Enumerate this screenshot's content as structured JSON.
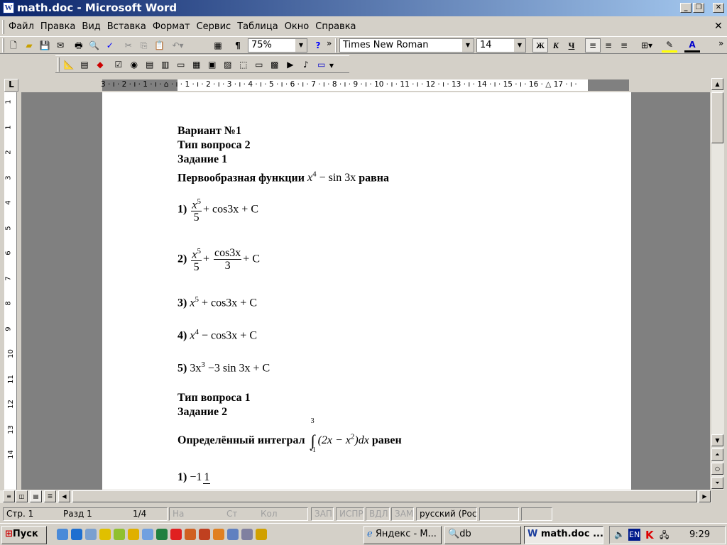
{
  "window": {
    "title": "math.doc - Microsoft Word",
    "icon_letter": "W",
    "minimize": "_",
    "restore": "❐",
    "close": "✕"
  },
  "menu": {
    "items": [
      "Файл",
      "Правка",
      "Вид",
      "Вставка",
      "Формат",
      "Сервис",
      "Таблица",
      "Окно",
      "Справка"
    ],
    "close_doc": "✕"
  },
  "toolbar": {
    "zoom": "75%",
    "pilcrow": "¶",
    "help": "?",
    "font": "Times New Roman",
    "size": "14",
    "bold": "Ж",
    "italic": "К",
    "underline": "Ч",
    "more": "»"
  },
  "ruler": {
    "corner": "L",
    "numbers": "3 · ı · 2 · ı · 1 · ı · ⌂ · ı · 1 · ı · 2 · ı · 3 · ı · 4 · ı · 5 · ı · 6 · ı · 7 · ı · 8 · ı · 9 · ı · 10 · ı · 11 · ı · 12 · ı · 13 · ı · 14 · ı · 15 · ı · 16 · △ 17 · ı ·",
    "vertical": [
      "1",
      "1",
      "2",
      "3",
      "4",
      "5",
      "6",
      "7",
      "8",
      "9",
      "10",
      "11",
      "12",
      "13",
      "14"
    ]
  },
  "document": {
    "variant": "Вариант №1",
    "type1": "Тип вопроса 2",
    "task1": "Задание 1",
    "q1_prefix": "Первообразная функции",
    "q1_expr": {
      "x": "x",
      "pow": "4",
      "rest": " − sin 3x"
    },
    "q1_suffix": "равна",
    "a1": {
      "n": "1)",
      "num": "x",
      "pow": "5",
      "den": "5",
      "rest": "+ cos3x + C"
    },
    "a2": {
      "n": "2)",
      "num": "x",
      "pow": "5",
      "den": "5",
      "plus": "+",
      "num2": "cos3x",
      "den2": "3",
      "rest": "+ C"
    },
    "a3": {
      "n": "3)",
      "x": "x",
      "pow": "5",
      "rest": " + cos3x + C"
    },
    "a4": {
      "n": "4)",
      "x": "x",
      "pow": "4",
      "rest": " − cos3x + C"
    },
    "a5": {
      "n": "5)",
      "x": "3x",
      "pow": "3",
      "rest": " −3 sin 3x + C"
    },
    "type2": "Тип вопроса 1",
    "task2": "Задание 2",
    "q2_prefix": "Определённый интеграл",
    "q2_integral": {
      "upper": "3",
      "lower": "-1",
      "sign": "∫",
      "body": "(2x − x",
      "pow": "2",
      "tail": ")dx"
    },
    "q2_suffix": "равен",
    "b1": {
      "n": "1)",
      "whole": "−1",
      "num": "1"
    }
  },
  "status": {
    "page": "Стр. 1",
    "section": "Разд 1",
    "pages": "1/4",
    "at": "На",
    "line": "Ст",
    "col": "Кол",
    "rec": "ЗАП",
    "trk": "ИСПР",
    "ext": "ВДЛ",
    "ovr": "ЗАМ",
    "lang": "русский (Рос"
  },
  "taskbar": {
    "start": "Пуск",
    "tasks": [
      "Яндекс - М...",
      "db",
      "math.doc ..."
    ],
    "lang": "EN",
    "clock": "9:29"
  }
}
